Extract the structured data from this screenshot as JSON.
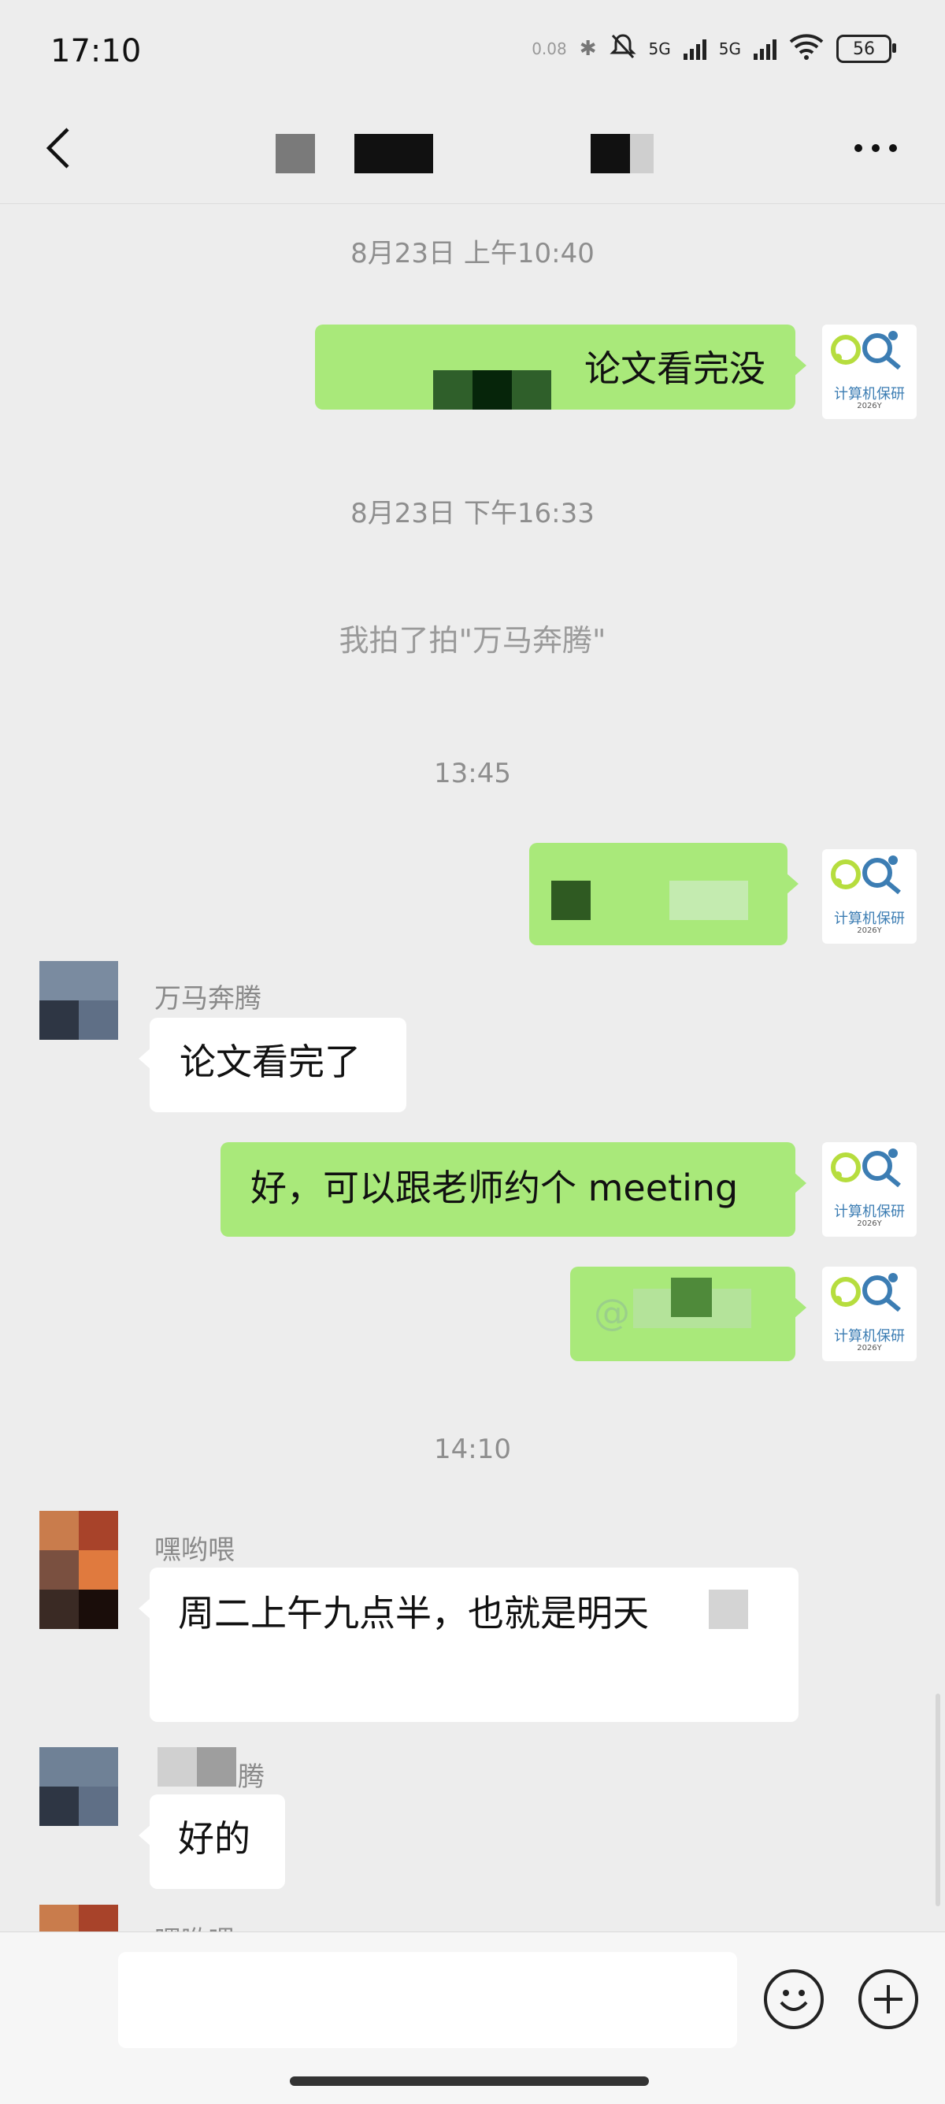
{
  "status": {
    "time": "17:10",
    "net_speed": "0.08",
    "net1": "5G",
    "net2": "5G",
    "battery": "56"
  },
  "header": {
    "back_icon": "chevron-left-icon",
    "more_icon": "ellipsis-icon"
  },
  "messages": {
    "ts1": "8月23日 上午10:40",
    "m1": "论文看完没",
    "ts2": "8月23日 下午16:33",
    "system1": "我拍了拍\"万马奔腾\"",
    "ts3": "13:45",
    "sender1": "万马奔腾",
    "m3": "论文看完了",
    "m4": "好，可以跟老师约个 meeting",
    "m5": "@",
    "ts4": "14:10",
    "sender2": "嘿哟喂",
    "m6": "周二上午九点半，也就是明天",
    "sender3": "腾",
    "m7": "好的",
    "sender4": "嘿哟喂"
  },
  "self_avatar": {
    "label": "计算机保研",
    "sub": "2026Y"
  },
  "colors": {
    "green_bubble": "#a9e97a",
    "white_bubble": "#ffffff",
    "background": "#ededed"
  },
  "input_bar": {
    "emoji_icon": "smile-icon",
    "add_icon": "plus-circle-icon"
  }
}
